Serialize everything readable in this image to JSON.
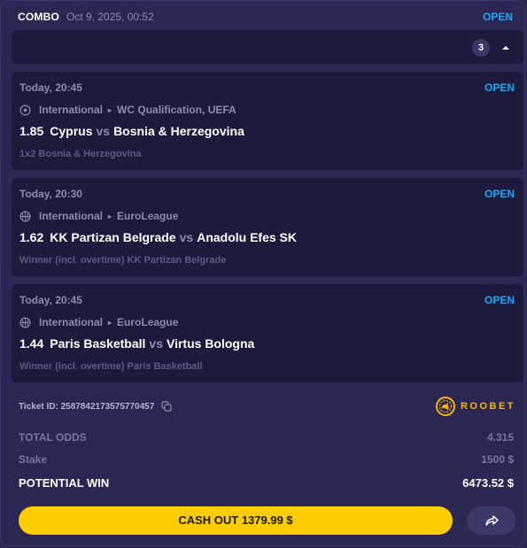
{
  "header": {
    "type_label": "COMBO",
    "datetime": "Oct 9, 2025, 00:52",
    "status": "OPEN"
  },
  "selections_count": "3",
  "bets": [
    {
      "time": "Today, 20:45",
      "status": "OPEN",
      "sport_icon": "soccer-ball-icon",
      "category": "International",
      "league": "WC Qualification, UEFA",
      "odds": "1.85",
      "home": "Cyprus",
      "vs": "vs",
      "away": "Bosnia & Herzegovina",
      "market": "1x2 Bosnia & Herzegovina"
    },
    {
      "time": "Today, 20:30",
      "status": "OPEN",
      "sport_icon": "basketball-icon",
      "category": "International",
      "league": "EuroLeague",
      "odds": "1.62",
      "home": "KK Partizan Belgrade",
      "vs": "vs",
      "away": "Anadolu Efes SK",
      "market": "Winner (incl. overtime) KK Partizan Belgrade"
    },
    {
      "time": "Today, 20:45",
      "status": "OPEN",
      "sport_icon": "basketball-icon",
      "category": "International",
      "league": "EuroLeague",
      "odds": "1.44",
      "home": "Paris Basketball",
      "vs": "vs",
      "away": "Virtus Bologna",
      "market": "Winner (incl. overtime) Paris Basketball"
    }
  ],
  "ticket": {
    "id_text": "Ticket ID: 2587842173575770457"
  },
  "brand": {
    "name": "ROOBET"
  },
  "summary": {
    "total_odds_label": "TOTAL ODDS",
    "total_odds_value": "4.315",
    "stake_label": "Stake",
    "stake_value": "1500 $",
    "potential_win_label": "POTENTIAL WIN",
    "potential_win_value": "6473.52 $"
  },
  "actions": {
    "cashout_label": "CASH OUT 1379.99 $",
    "share_icon": "share-arrow-icon"
  },
  "colors": {
    "accent_blue": "#1ea7ff",
    "cashout_yellow": "#ffcc00",
    "brand_gold": "#f5b800",
    "card_bg": "#1d1a3e",
    "panel_bg": "#2b2752"
  }
}
